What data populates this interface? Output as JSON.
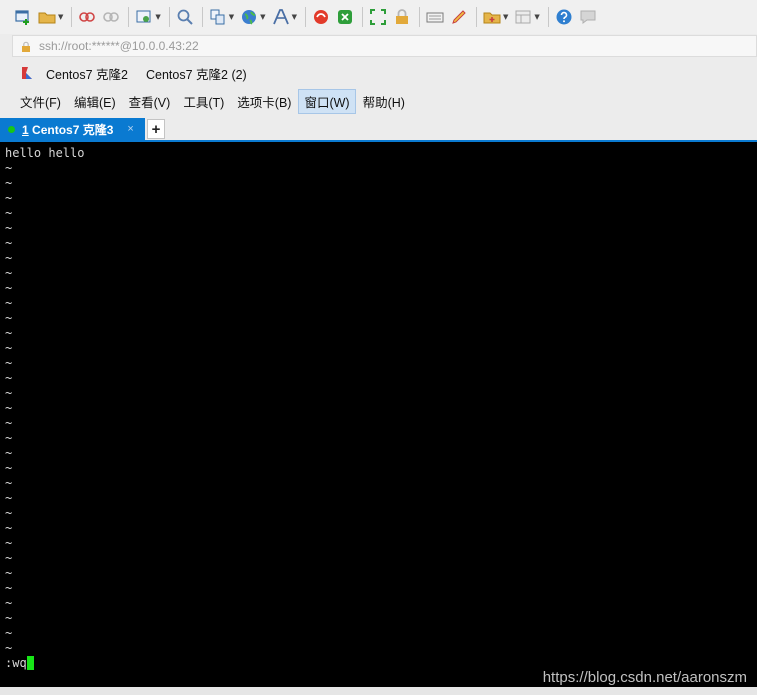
{
  "toolbar": {
    "icons": [
      "new-session-icon",
      "open-folder-icon",
      "reconnect-icon",
      "disconnect-icon",
      "properties-icon",
      "find-icon",
      "transfer-icon",
      "globe-icon",
      "font-icon",
      "xftp-icon",
      "xshell-green-icon",
      "fullscreen-icon",
      "lock-icon",
      "keyboard-icon",
      "highlight-pen-icon",
      "new-tab-icon",
      "layout-icon",
      "help-icon",
      "chat-icon"
    ]
  },
  "address": {
    "text": "ssh://root:******@10.0.0.43:22"
  },
  "bookmarks": {
    "items": [
      "Centos7 克隆2",
      "Centos7 克隆2 (2)"
    ]
  },
  "menu": {
    "items": [
      "文件(F)",
      "编辑(E)",
      "查看(V)",
      "工具(T)",
      "选项卡(B)",
      "窗口(W)",
      "帮助(H)"
    ],
    "active_index": 5
  },
  "tab": {
    "number": "1",
    "label": " Centos7 克隆3",
    "close": "×",
    "add": "+"
  },
  "terminal": {
    "first_line": "hello hello",
    "tilde": "~",
    "command": ":wq",
    "watermark": "https://blog.csdn.net/aaronszm"
  },
  "colors": {
    "tab_active": "#0a7ad1",
    "cursor": "#17e617",
    "terminal_bg": "#000000"
  }
}
